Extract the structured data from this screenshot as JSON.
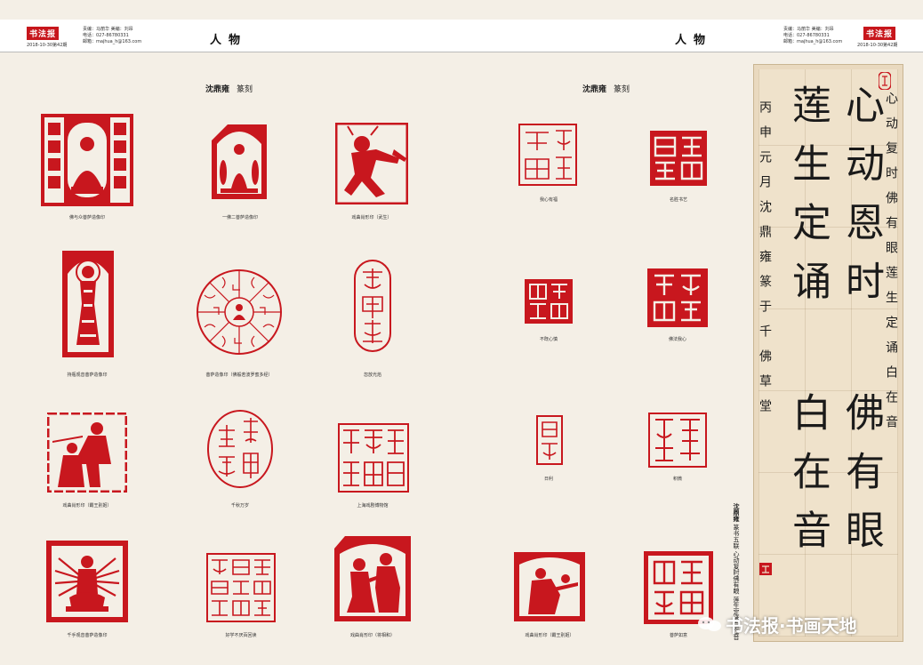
{
  "header": {
    "logo_text": "书法报",
    "issue_line": "2018-10-30第42期",
    "credit_editor": "责编：马丽华 美编：刘昂",
    "credit_phone": "电话：027-86780331",
    "credit_email": "邮箱：majhua_h@163.com",
    "section": "人物"
  },
  "left_page": {
    "artist": "沈鼎雍",
    "category": "篆刻",
    "seals": [
      {
        "caption": "佛与众菩萨造像印"
      },
      {
        "caption": "一佛二菩萨造像印"
      },
      {
        "caption": "戏曲肖形印（武生）"
      },
      {
        "caption": "持瓶观音菩萨造像印"
      },
      {
        "caption": "菩萨造像印（佛般若波罗蜜多经）"
      },
      {
        "caption": "忽放光焰"
      },
      {
        "caption": "戏曲肖形印（霸王别姬）"
      },
      {
        "caption": "千秋万岁"
      },
      {
        "caption": "上海戏剧博物馆"
      },
      {
        "caption": "千手观音菩萨造像印"
      },
      {
        "caption": "好学不厌百回读"
      },
      {
        "caption": "戏曲肖形印（将相和）"
      }
    ]
  },
  "right_page": {
    "artist": "沈鼎雍",
    "category": "篆刻",
    "seals": [
      {
        "caption": "我心有福"
      },
      {
        "caption": "名胜书艺"
      },
      {
        "caption": "不既心慎"
      },
      {
        "caption": "佛法我心"
      },
      {
        "caption": "日利"
      },
      {
        "caption": "积微"
      },
      {
        "caption": "戏曲肖形印（霸王别姬）"
      },
      {
        "caption": "菩萨如意"
      }
    ],
    "calligraphy": {
      "big_col_1": "心动恩时",
      "big_col_2": "莲生定诵",
      "big_col_3": "佛有眼",
      "big_col_4": "白在音",
      "small_col_1": "心动复时佛有眼莲生定诵白在音",
      "small_col_2": "丙申元月沈鼎雍篆于千佛草堂",
      "caption_name": "沈鼎雍",
      "caption_title": "篆书五联",
      "caption_text": "心动复时佛有眼 莲生定诵白在音"
    },
    "watermark": "书法报·书画天地"
  },
  "colors": {
    "seal_red": "#c8171e",
    "logo_red": "#c7161c",
    "paper": "#f4efe6"
  }
}
